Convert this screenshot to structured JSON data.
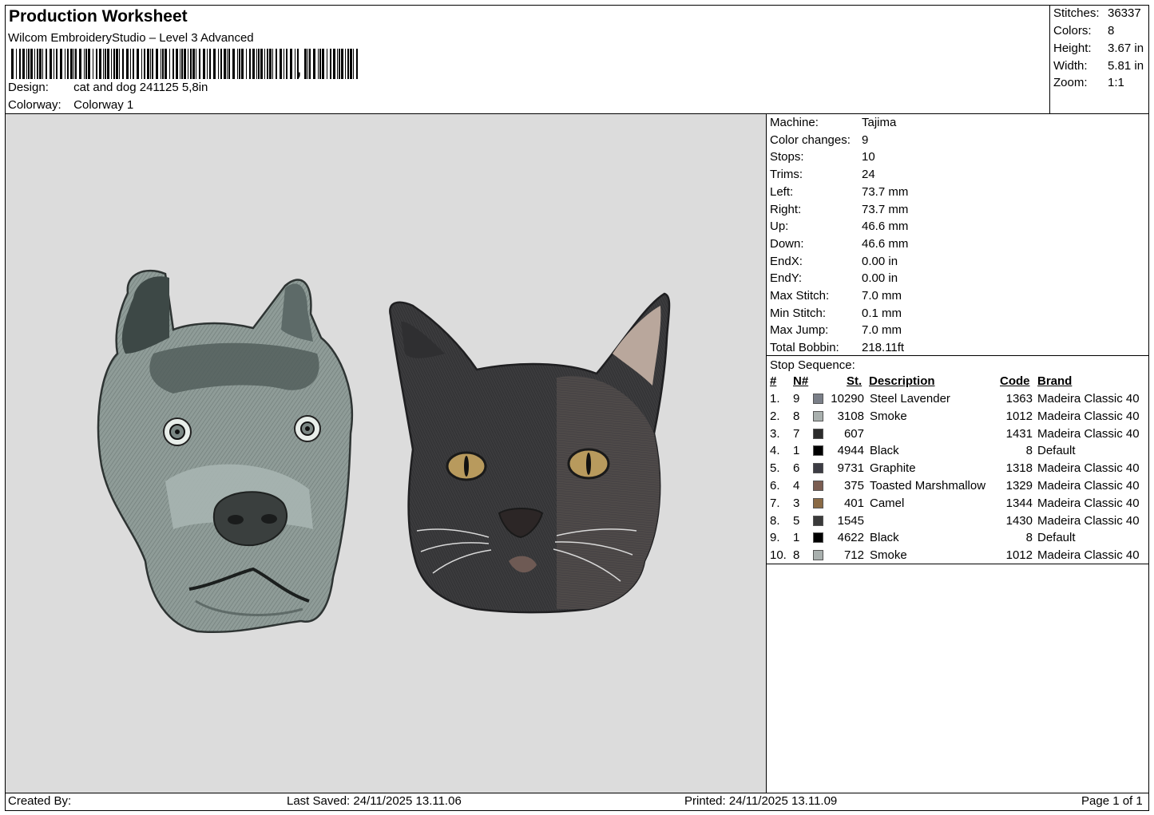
{
  "header": {
    "title": "Production Worksheet",
    "software": "Wilcom EmbroideryStudio – Level 3 Advanced",
    "design_label": "Design:",
    "design_value": "cat and dog 241125 5,8in",
    "colorway_label": "Colorway:",
    "colorway_value": "Colorway 1"
  },
  "stats": [
    {
      "label": "Stitches:",
      "value": "36337"
    },
    {
      "label": "Colors:",
      "value": "8"
    },
    {
      "label": "Height:",
      "value": "3.67 in"
    },
    {
      "label": "Width:",
      "value": "5.81 in"
    },
    {
      "label": "Zoom:",
      "value": "1:1"
    }
  ],
  "machine_info": [
    {
      "label": "Machine:",
      "value": "Tajima"
    },
    {
      "label": "Color changes:",
      "value": "9"
    },
    {
      "label": "Stops:",
      "value": "10"
    },
    {
      "label": "Trims:",
      "value": "24"
    },
    {
      "label": "Left:",
      "value": "73.7 mm"
    },
    {
      "label": "Right:",
      "value": "73.7 mm"
    },
    {
      "label": "Up:",
      "value": "46.6 mm"
    },
    {
      "label": "Down:",
      "value": "46.6 mm"
    },
    {
      "label": "EndX:",
      "value": "0.00 in"
    },
    {
      "label": "EndY:",
      "value": "0.00 in"
    },
    {
      "label": "Max Stitch:",
      "value": "7.0 mm"
    },
    {
      "label": "Min Stitch:",
      "value": "0.1 mm"
    },
    {
      "label": "Max Jump:",
      "value": "7.0 mm"
    },
    {
      "label": "Total Bobbin:",
      "value": "218.11ft"
    }
  ],
  "stop_sequence": {
    "title": "Stop Sequence:",
    "columns": {
      "num": "#",
      "n": "N#",
      "st": "St.",
      "description": "Description",
      "code": "Code",
      "brand": "Brand"
    },
    "rows": [
      {
        "num": "1.",
        "n": "9",
        "color": "#7a7f88",
        "st": "10290",
        "description": "Steel Lavender",
        "code": "1363",
        "brand": "Madeira Classic 40"
      },
      {
        "num": "2.",
        "n": "8",
        "color": "#a9b0ae",
        "st": "3108",
        "description": "Smoke",
        "code": "1012",
        "brand": "Madeira Classic 40"
      },
      {
        "num": "3.",
        "n": "7",
        "color": "#2b2b2b",
        "st": "607",
        "description": "",
        "code": "1431",
        "brand": "Madeira Classic 40"
      },
      {
        "num": "4.",
        "n": "1",
        "color": "#000000",
        "st": "4944",
        "description": "Black",
        "code": "8",
        "brand": "Default"
      },
      {
        "num": "5.",
        "n": "6",
        "color": "#3c3c44",
        "st": "9731",
        "description": "Graphite",
        "code": "1318",
        "brand": "Madeira Classic 40"
      },
      {
        "num": "6.",
        "n": "4",
        "color": "#7b5e52",
        "st": "375",
        "description": "Toasted Marshmallow",
        "code": "1329",
        "brand": "Madeira Classic 40"
      },
      {
        "num": "7.",
        "n": "3",
        "color": "#8a6a45",
        "st": "401",
        "description": "Camel",
        "code": "1344",
        "brand": "Madeira Classic 40"
      },
      {
        "num": "8.",
        "n": "5",
        "color": "#3a3a3a",
        "st": "1545",
        "description": "",
        "code": "1430",
        "brand": "Madeira Classic 40"
      },
      {
        "num": "9.",
        "n": "1",
        "color": "#000000",
        "st": "4622",
        "description": "Black",
        "code": "8",
        "brand": "Default"
      },
      {
        "num": "10.",
        "n": "8",
        "color": "#a9b0ae",
        "st": "712",
        "description": "Smoke",
        "code": "1012",
        "brand": "Madeira Classic 40"
      }
    ]
  },
  "footer": {
    "created_by": "Created By:",
    "last_saved": "Last Saved: 24/11/2025 13.11.06",
    "printed": "Printed: 24/11/2025 13.11.09",
    "page": "Page 1 of 1"
  }
}
